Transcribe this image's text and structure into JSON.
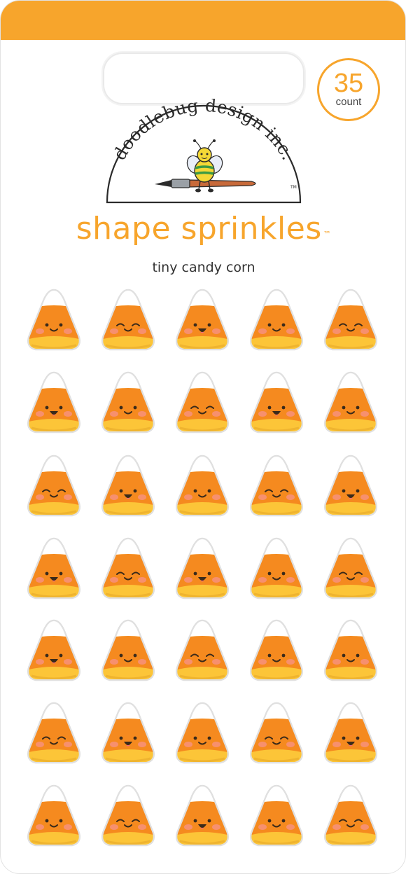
{
  "header": {
    "count_number": "35",
    "count_label": "count"
  },
  "brand": {
    "name": "doodlebug design inc.",
    "mark": "TM"
  },
  "product": {
    "title": "shape sprinkles",
    "title_mark": "™",
    "subtitle": "tiny candy corn"
  },
  "colors": {
    "band": "#f7a52c",
    "title": "#f7a52c",
    "candy_orange": "#f58a1f",
    "candy_yellow": "#fcc538",
    "candy_tip": "#ffffff",
    "blush": "#f7907c",
    "outline": "#d9d9d9"
  },
  "stickers": {
    "count": 35,
    "rows": 7,
    "columns": 5,
    "icon": "candy-corn-icon",
    "faces": [
      "smile",
      "wink",
      "open",
      "smile",
      "wink",
      "open",
      "smile",
      "wink",
      "open",
      "smile",
      "wink",
      "open",
      "smile",
      "wink",
      "open",
      "open",
      "wink",
      "open",
      "smile",
      "wink",
      "open",
      "smile",
      "wink",
      "smile",
      "smile",
      "wink",
      "open",
      "smile",
      "wink",
      "open",
      "smile",
      "wink",
      "open",
      "smile",
      "wink"
    ]
  }
}
